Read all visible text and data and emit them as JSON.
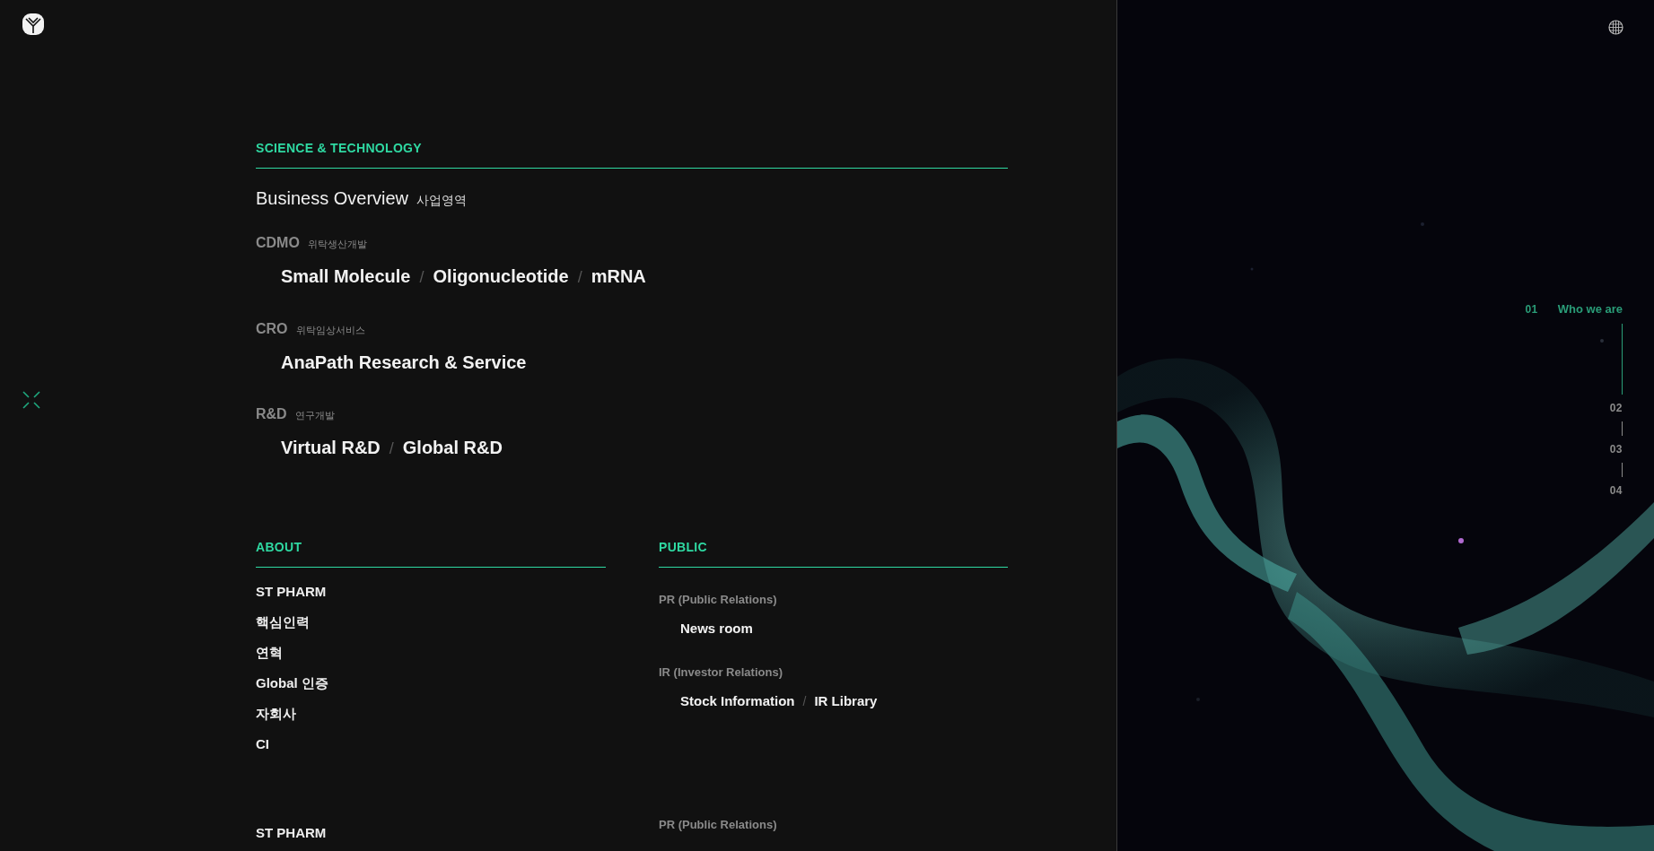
{
  "menu": {
    "science": {
      "title": "SCIENCE & TECHNOLOGY",
      "overview": {
        "label": "Business Overview",
        "label_ko": "사업영역"
      },
      "groups": [
        {
          "label": "CDMO",
          "label_ko": "위탁생산개발",
          "links": [
            {
              "label": "Small Molecule"
            },
            {
              "separator": "/",
              "label": "Oligonucleotide"
            },
            {
              "separator": "/",
              "label": "mRNA"
            }
          ]
        },
        {
          "label": "CRO",
          "label_ko": "위탁임상서비스",
          "links": [
            {
              "label": "AnaPath Research & Service"
            }
          ]
        },
        {
          "label": "R&D",
          "label_ko": "연구개발",
          "links": [
            {
              "label": "Virtual R&D"
            },
            {
              "separator": "/",
              "label": "Global R&D"
            }
          ]
        }
      ]
    },
    "about": {
      "title": "ABOUT",
      "items": [
        "ST PHARM",
        "핵심인력",
        "연혁",
        "Global 인증",
        "자회사",
        "CI"
      ]
    },
    "public": {
      "title": "PUBLIC",
      "groups": [
        {
          "label": "PR (Public Relations)",
          "links": [
            {
              "label": "News room"
            }
          ]
        },
        {
          "label": "IR (Investor Relations)",
          "links": [
            {
              "label": "Stock Information"
            },
            {
              "separator": "/",
              "label": "IR Library"
            }
          ]
        }
      ]
    },
    "next": {
      "about_items": [
        "ST PHARM"
      ],
      "public_labels": [
        "PR (Public Relations)"
      ]
    }
  },
  "section_nav": [
    {
      "number": "01",
      "label": "Who we are",
      "selected": true
    },
    {
      "number": "02",
      "selected": false
    },
    {
      "number": "03",
      "selected": false
    },
    {
      "number": "04",
      "selected": false
    }
  ]
}
